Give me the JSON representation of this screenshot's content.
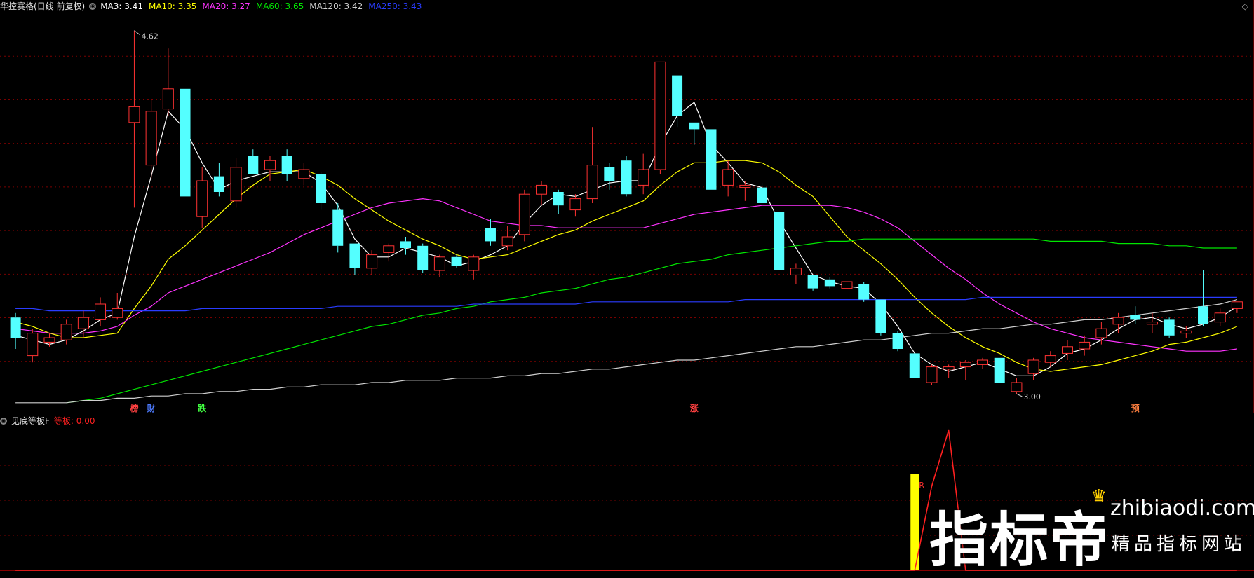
{
  "main_panel": {
    "title": "华控赛格(日线 前复权)",
    "indicators": [
      {
        "label": "MA3: 3.41",
        "color": "#ffffff"
      },
      {
        "label": "MA10: 3.35",
        "color": "#ffff00"
      },
      {
        "label": "MA20: 3.27",
        "color": "#ff33ff"
      },
      {
        "label": "MA60: 3.65",
        "color": "#00e600"
      },
      {
        "label": "MA120: 3.42",
        "color": "#d0d0d0"
      },
      {
        "label": "MA250: 3.43",
        "color": "#2a3cff"
      }
    ],
    "high_label": "4.62",
    "low_label": "3.00",
    "event_markers": [
      {
        "text": "榜",
        "color": "#ff4040",
        "index": 7
      },
      {
        "text": "财",
        "color": "#4d7bff",
        "index": 8
      },
      {
        "text": "跌",
        "color": "#40ff40",
        "index": 11
      },
      {
        "text": "涨",
        "color": "#ff4040",
        "index": 40
      },
      {
        "text": "预",
        "color": "#ff8040",
        "index": 66
      }
    ]
  },
  "sub_panel": {
    "title": "见底等板F",
    "indicator": {
      "label": "等板: 0.00",
      "color": "#ff2020"
    },
    "bar_marker": "R"
  },
  "colors": {
    "up": "#ff3232",
    "down": "#54ffff",
    "grid": "#7a0000",
    "background": "#000000"
  },
  "watermark": {
    "brand": "指标帝",
    "url": "zhibiaodi.com",
    "slogan": "精品指标网站"
  },
  "chart_data": {
    "type": "candlestick",
    "price_range": [
      2.95,
      4.7
    ],
    "candles": [
      {
        "o": 3.25,
        "c": 3.34,
        "h": 3.36,
        "l": 3.2,
        "up": false
      },
      {
        "o": 3.27,
        "c": 3.17,
        "h": 3.29,
        "l": 3.14,
        "up": true
      },
      {
        "o": 3.23,
        "c": 3.25,
        "h": 3.27,
        "l": 3.21,
        "up": true
      },
      {
        "o": 3.24,
        "c": 3.31,
        "h": 3.33,
        "l": 3.22,
        "up": true
      },
      {
        "o": 3.29,
        "c": 3.34,
        "h": 3.37,
        "l": 3.25,
        "up": true
      },
      {
        "o": 3.33,
        "c": 3.4,
        "h": 3.43,
        "l": 3.3,
        "up": true
      },
      {
        "o": 3.34,
        "c": 3.38,
        "h": 3.45,
        "l": 3.33,
        "up": true
      },
      {
        "o": 4.21,
        "c": 4.28,
        "h": 4.62,
        "l": 3.83,
        "up": true
      },
      {
        "o": 4.02,
        "c": 4.26,
        "h": 4.31,
        "l": 3.96,
        "up": true
      },
      {
        "o": 4.27,
        "c": 4.36,
        "h": 4.54,
        "l": 4.24,
        "up": true
      },
      {
        "o": 4.36,
        "c": 3.88,
        "h": 4.36,
        "l": 3.88,
        "up": false
      },
      {
        "o": 3.79,
        "c": 3.95,
        "h": 4.01,
        "l": 3.74,
        "up": true
      },
      {
        "o": 3.97,
        "c": 3.9,
        "h": 4.03,
        "l": 3.88,
        "up": false
      },
      {
        "o": 3.86,
        "c": 4.01,
        "h": 4.05,
        "l": 3.83,
        "up": true
      },
      {
        "o": 4.06,
        "c": 3.98,
        "h": 4.09,
        "l": 3.98,
        "up": false
      },
      {
        "o": 4.04,
        "c": 4.0,
        "h": 4.06,
        "l": 3.95,
        "up": true
      },
      {
        "o": 4.06,
        "c": 3.98,
        "h": 4.09,
        "l": 3.95,
        "up": false
      },
      {
        "o": 3.96,
        "c": 4.0,
        "h": 4.03,
        "l": 3.93,
        "up": true
      },
      {
        "o": 3.98,
        "c": 3.85,
        "h": 3.99,
        "l": 3.82,
        "up": false
      },
      {
        "o": 3.82,
        "c": 3.66,
        "h": 3.85,
        "l": 3.63,
        "up": false
      },
      {
        "o": 3.67,
        "c": 3.56,
        "h": 3.67,
        "l": 3.53,
        "up": false
      },
      {
        "o": 3.56,
        "c": 3.62,
        "h": 3.64,
        "l": 3.53,
        "up": true
      },
      {
        "o": 3.63,
        "c": 3.66,
        "h": 3.67,
        "l": 3.59,
        "up": true
      },
      {
        "o": 3.65,
        "c": 3.68,
        "h": 3.7,
        "l": 3.62,
        "up": false
      },
      {
        "o": 3.66,
        "c": 3.55,
        "h": 3.67,
        "l": 3.54,
        "up": false
      },
      {
        "o": 3.55,
        "c": 3.61,
        "h": 3.62,
        "l": 3.52,
        "up": true
      },
      {
        "o": 3.61,
        "c": 3.57,
        "h": 3.62,
        "l": 3.56,
        "up": false
      },
      {
        "o": 3.55,
        "c": 3.61,
        "h": 3.62,
        "l": 3.51,
        "up": true
      },
      {
        "o": 3.74,
        "c": 3.68,
        "h": 3.78,
        "l": 3.66,
        "up": false
      },
      {
        "o": 3.66,
        "c": 3.7,
        "h": 3.75,
        "l": 3.64,
        "up": true
      },
      {
        "o": 3.71,
        "c": 3.89,
        "h": 3.91,
        "l": 3.68,
        "up": true
      },
      {
        "o": 3.89,
        "c": 3.93,
        "h": 3.95,
        "l": 3.84,
        "up": true
      },
      {
        "o": 3.9,
        "c": 3.84,
        "h": 3.91,
        "l": 3.8,
        "up": false
      },
      {
        "o": 3.82,
        "c": 3.87,
        "h": 3.89,
        "l": 3.79,
        "up": true
      },
      {
        "o": 3.87,
        "c": 4.02,
        "h": 4.19,
        "l": 3.85,
        "up": true
      },
      {
        "o": 4.01,
        "c": 3.95,
        "h": 4.03,
        "l": 3.91,
        "up": false
      },
      {
        "o": 4.04,
        "c": 3.89,
        "h": 4.06,
        "l": 3.88,
        "up": false
      },
      {
        "o": 3.93,
        "c": 4.0,
        "h": 4.07,
        "l": 3.89,
        "up": true
      },
      {
        "o": 4.0,
        "c": 4.48,
        "h": 4.48,
        "l": 3.98,
        "up": true
      },
      {
        "o": 4.42,
        "c": 4.24,
        "h": 4.42,
        "l": 4.19,
        "up": false
      },
      {
        "o": 4.21,
        "c": 4.18,
        "h": 4.21,
        "l": 4.11,
        "up": false
      },
      {
        "o": 4.18,
        "c": 3.91,
        "h": 4.18,
        "l": 3.91,
        "up": false
      },
      {
        "o": 3.93,
        "c": 4.0,
        "h": 4.04,
        "l": 3.88,
        "up": true
      },
      {
        "o": 3.93,
        "c": 3.92,
        "h": 3.95,
        "l": 3.86,
        "up": true
      },
      {
        "o": 3.92,
        "c": 3.85,
        "h": 3.94,
        "l": 3.85,
        "up": false
      },
      {
        "o": 3.81,
        "c": 3.55,
        "h": 3.81,
        "l": 3.55,
        "up": false
      },
      {
        "o": 3.53,
        "c": 3.56,
        "h": 3.58,
        "l": 3.49,
        "up": true
      },
      {
        "o": 3.53,
        "c": 3.47,
        "h": 3.53,
        "l": 3.46,
        "up": false
      },
      {
        "o": 3.51,
        "c": 3.48,
        "h": 3.52,
        "l": 3.47,
        "up": false
      },
      {
        "o": 3.47,
        "c": 3.5,
        "h": 3.54,
        "l": 3.46,
        "up": true
      },
      {
        "o": 3.49,
        "c": 3.42,
        "h": 3.5,
        "l": 3.41,
        "up": false
      },
      {
        "o": 3.42,
        "c": 3.27,
        "h": 3.42,
        "l": 3.26,
        "up": false
      },
      {
        "o": 3.27,
        "c": 3.2,
        "h": 3.28,
        "l": 3.19,
        "up": false
      },
      {
        "o": 3.18,
        "c": 3.07,
        "h": 3.18,
        "l": 3.07,
        "up": false
      },
      {
        "o": 3.05,
        "c": 3.12,
        "h": 3.13,
        "l": 3.04,
        "up": true
      },
      {
        "o": 3.11,
        "c": 3.12,
        "h": 3.13,
        "l": 3.07,
        "up": true
      },
      {
        "o": 3.12,
        "c": 3.14,
        "h": 3.15,
        "l": 3.06,
        "up": true
      },
      {
        "o": 3.13,
        "c": 3.15,
        "h": 3.16,
        "l": 3.11,
        "up": true
      },
      {
        "o": 3.16,
        "c": 3.05,
        "h": 3.16,
        "l": 3.05,
        "up": false
      },
      {
        "o": 3.01,
        "c": 3.05,
        "h": 3.07,
        "l": 3.0,
        "up": true
      },
      {
        "o": 3.09,
        "c": 3.15,
        "h": 3.16,
        "l": 3.06,
        "up": true
      },
      {
        "o": 3.14,
        "c": 3.17,
        "h": 3.19,
        "l": 3.12,
        "up": true
      },
      {
        "o": 3.18,
        "c": 3.21,
        "h": 3.24,
        "l": 3.15,
        "up": true
      },
      {
        "o": 3.2,
        "c": 3.23,
        "h": 3.26,
        "l": 3.17,
        "up": true
      },
      {
        "o": 3.25,
        "c": 3.29,
        "h": 3.32,
        "l": 3.22,
        "up": true
      },
      {
        "o": 3.31,
        "c": 3.34,
        "h": 3.36,
        "l": 3.27,
        "up": true
      },
      {
        "o": 3.33,
        "c": 3.35,
        "h": 3.39,
        "l": 3.31,
        "up": false
      },
      {
        "o": 3.31,
        "c": 3.32,
        "h": 3.36,
        "l": 3.27,
        "up": true
      },
      {
        "o": 3.33,
        "c": 3.26,
        "h": 3.34,
        "l": 3.25,
        "up": false
      },
      {
        "o": 3.27,
        "c": 3.28,
        "h": 3.3,
        "l": 3.25,
        "up": true
      },
      {
        "o": 3.31,
        "c": 3.39,
        "h": 3.55,
        "l": 3.3,
        "up": false
      },
      {
        "o": 3.32,
        "c": 3.36,
        "h": 3.38,
        "l": 3.3,
        "up": true
      },
      {
        "o": 3.38,
        "c": 3.41,
        "h": 3.41,
        "l": 3.36,
        "up": true
      }
    ],
    "ma_lines": [
      {
        "name": "MA3",
        "color": "#ffffff",
        "values": [
          3.26,
          3.24,
          3.22,
          3.24,
          3.28,
          3.33,
          3.36,
          3.7,
          3.97,
          4.26,
          4.18,
          4.03,
          3.91,
          3.95,
          3.97,
          3.99,
          3.99,
          3.99,
          3.94,
          3.84,
          3.69,
          3.61,
          3.61,
          3.65,
          3.63,
          3.61,
          3.57,
          3.59,
          3.62,
          3.66,
          3.76,
          3.84,
          3.89,
          3.88,
          3.91,
          3.94,
          3.95,
          3.95,
          4.11,
          4.24,
          4.3,
          4.11,
          4.03,
          3.94,
          3.92,
          3.77,
          3.65,
          3.53,
          3.5,
          3.48,
          3.47,
          3.4,
          3.3,
          3.18,
          3.13,
          3.1,
          3.12,
          3.14,
          3.11,
          3.08,
          3.08,
          3.12,
          3.18,
          3.2,
          3.24,
          3.29,
          3.33,
          3.34,
          3.31,
          3.29,
          3.31,
          3.34,
          3.39
        ]
      },
      {
        "name": "MA10",
        "color": "#ffff00",
        "values": [
          3.32,
          3.3,
          3.27,
          3.25,
          3.25,
          3.26,
          3.27,
          3.38,
          3.48,
          3.6,
          3.66,
          3.73,
          3.8,
          3.87,
          3.93,
          3.98,
          3.99,
          4.0,
          3.97,
          3.93,
          3.87,
          3.82,
          3.77,
          3.73,
          3.69,
          3.66,
          3.62,
          3.6,
          3.61,
          3.62,
          3.65,
          3.68,
          3.71,
          3.73,
          3.77,
          3.8,
          3.83,
          3.86,
          3.93,
          3.99,
          4.03,
          4.03,
          4.04,
          4.04,
          4.03,
          3.99,
          3.93,
          3.88,
          3.79,
          3.7,
          3.64,
          3.58,
          3.51,
          3.43,
          3.36,
          3.3,
          3.25,
          3.21,
          3.18,
          3.14,
          3.11,
          3.1,
          3.11,
          3.12,
          3.13,
          3.15,
          3.17,
          3.19,
          3.22,
          3.23,
          3.25,
          3.27,
          3.3
        ]
      },
      {
        "name": "MA20",
        "color": "#ff33ff",
        "values": [
          3.29,
          3.28,
          3.27,
          3.27,
          3.27,
          3.28,
          3.3,
          3.35,
          3.39,
          3.45,
          3.48,
          3.51,
          3.54,
          3.57,
          3.6,
          3.63,
          3.67,
          3.71,
          3.74,
          3.77,
          3.8,
          3.83,
          3.85,
          3.86,
          3.87,
          3.86,
          3.83,
          3.8,
          3.77,
          3.76,
          3.75,
          3.75,
          3.74,
          3.74,
          3.74,
          3.74,
          3.74,
          3.74,
          3.76,
          3.78,
          3.8,
          3.81,
          3.82,
          3.83,
          3.84,
          3.84,
          3.84,
          3.84,
          3.84,
          3.83,
          3.81,
          3.78,
          3.74,
          3.68,
          3.62,
          3.56,
          3.51,
          3.45,
          3.4,
          3.36,
          3.32,
          3.29,
          3.27,
          3.25,
          3.24,
          3.23,
          3.22,
          3.21,
          3.2,
          3.19,
          3.19,
          3.19,
          3.2
        ]
      },
      {
        "name": "MA60",
        "color": "#00e600",
        "values": [
          null,
          null,
          null,
          2.96,
          2.97,
          2.98,
          3.0,
          3.02,
          3.04,
          3.06,
          3.08,
          3.1,
          3.12,
          3.14,
          3.16,
          3.18,
          3.2,
          3.22,
          3.24,
          3.26,
          3.28,
          3.3,
          3.31,
          3.33,
          3.35,
          3.36,
          3.38,
          3.39,
          3.41,
          3.42,
          3.43,
          3.45,
          3.46,
          3.47,
          3.49,
          3.51,
          3.52,
          3.54,
          3.56,
          3.58,
          3.59,
          3.6,
          3.62,
          3.63,
          3.64,
          3.65,
          3.66,
          3.67,
          3.68,
          3.68,
          3.69,
          3.69,
          3.69,
          3.69,
          3.69,
          3.69,
          3.69,
          3.69,
          3.69,
          3.69,
          3.69,
          3.68,
          3.68,
          3.68,
          3.68,
          3.67,
          3.67,
          3.67,
          3.66,
          3.66,
          3.65,
          3.65,
          3.65
        ]
      },
      {
        "name": "MA120",
        "color": "#d0d0d0",
        "values": [
          2.96,
          2.96,
          2.96,
          2.96,
          2.97,
          2.97,
          2.98,
          2.98,
          2.99,
          2.99,
          3.0,
          3.0,
          3.01,
          3.01,
          3.02,
          3.02,
          3.03,
          3.03,
          3.04,
          3.04,
          3.04,
          3.05,
          3.05,
          3.06,
          3.06,
          3.06,
          3.07,
          3.07,
          3.07,
          3.08,
          3.08,
          3.09,
          3.09,
          3.1,
          3.11,
          3.11,
          3.12,
          3.13,
          3.14,
          3.15,
          3.15,
          3.16,
          3.17,
          3.18,
          3.19,
          3.2,
          3.21,
          3.21,
          3.22,
          3.23,
          3.24,
          3.24,
          3.25,
          3.26,
          3.27,
          3.27,
          3.28,
          3.29,
          3.29,
          3.3,
          3.31,
          3.31,
          3.32,
          3.33,
          3.33,
          3.34,
          3.35,
          3.36,
          3.37,
          3.38,
          3.39,
          3.4,
          3.42
        ]
      },
      {
        "name": "MA250",
        "color": "#2a3cff",
        "values": [
          3.38,
          3.38,
          3.37,
          3.37,
          3.37,
          3.37,
          3.37,
          3.37,
          3.37,
          3.37,
          3.37,
          3.38,
          3.38,
          3.38,
          3.38,
          3.38,
          3.38,
          3.38,
          3.38,
          3.39,
          3.39,
          3.39,
          3.39,
          3.39,
          3.39,
          3.39,
          3.39,
          3.4,
          3.4,
          3.4,
          3.4,
          3.4,
          3.4,
          3.4,
          3.41,
          3.41,
          3.41,
          3.41,
          3.41,
          3.41,
          3.41,
          3.41,
          3.41,
          3.42,
          3.42,
          3.42,
          3.42,
          3.42,
          3.42,
          3.42,
          3.42,
          3.42,
          3.42,
          3.42,
          3.42,
          3.42,
          3.42,
          3.43,
          3.43,
          3.43,
          3.43,
          3.43,
          3.43,
          3.43,
          3.43,
          3.43,
          3.43,
          3.43,
          3.43,
          3.43,
          3.43,
          3.43,
          3.43
        ]
      }
    ],
    "sub_series": {
      "name": "等板",
      "values": [
        0,
        0,
        0,
        0,
        0,
        0,
        0,
        0,
        0,
        0,
        0,
        0,
        0,
        0,
        0,
        0,
        0,
        0,
        0,
        0,
        0,
        0,
        0,
        0,
        0,
        0,
        0,
        0,
        0,
        0,
        0,
        0,
        0,
        0,
        0,
        0,
        0,
        0,
        0,
        0,
        0,
        0,
        0,
        0,
        0,
        0,
        0,
        0,
        0,
        0,
        0,
        0,
        0,
        0,
        0.6,
        1,
        0,
        0,
        0,
        0,
        0,
        0,
        0,
        0,
        0,
        0,
        0,
        0,
        0,
        0,
        0,
        0,
        0
      ],
      "bar_index": 53,
      "range": [
        0,
        1
      ]
    }
  }
}
